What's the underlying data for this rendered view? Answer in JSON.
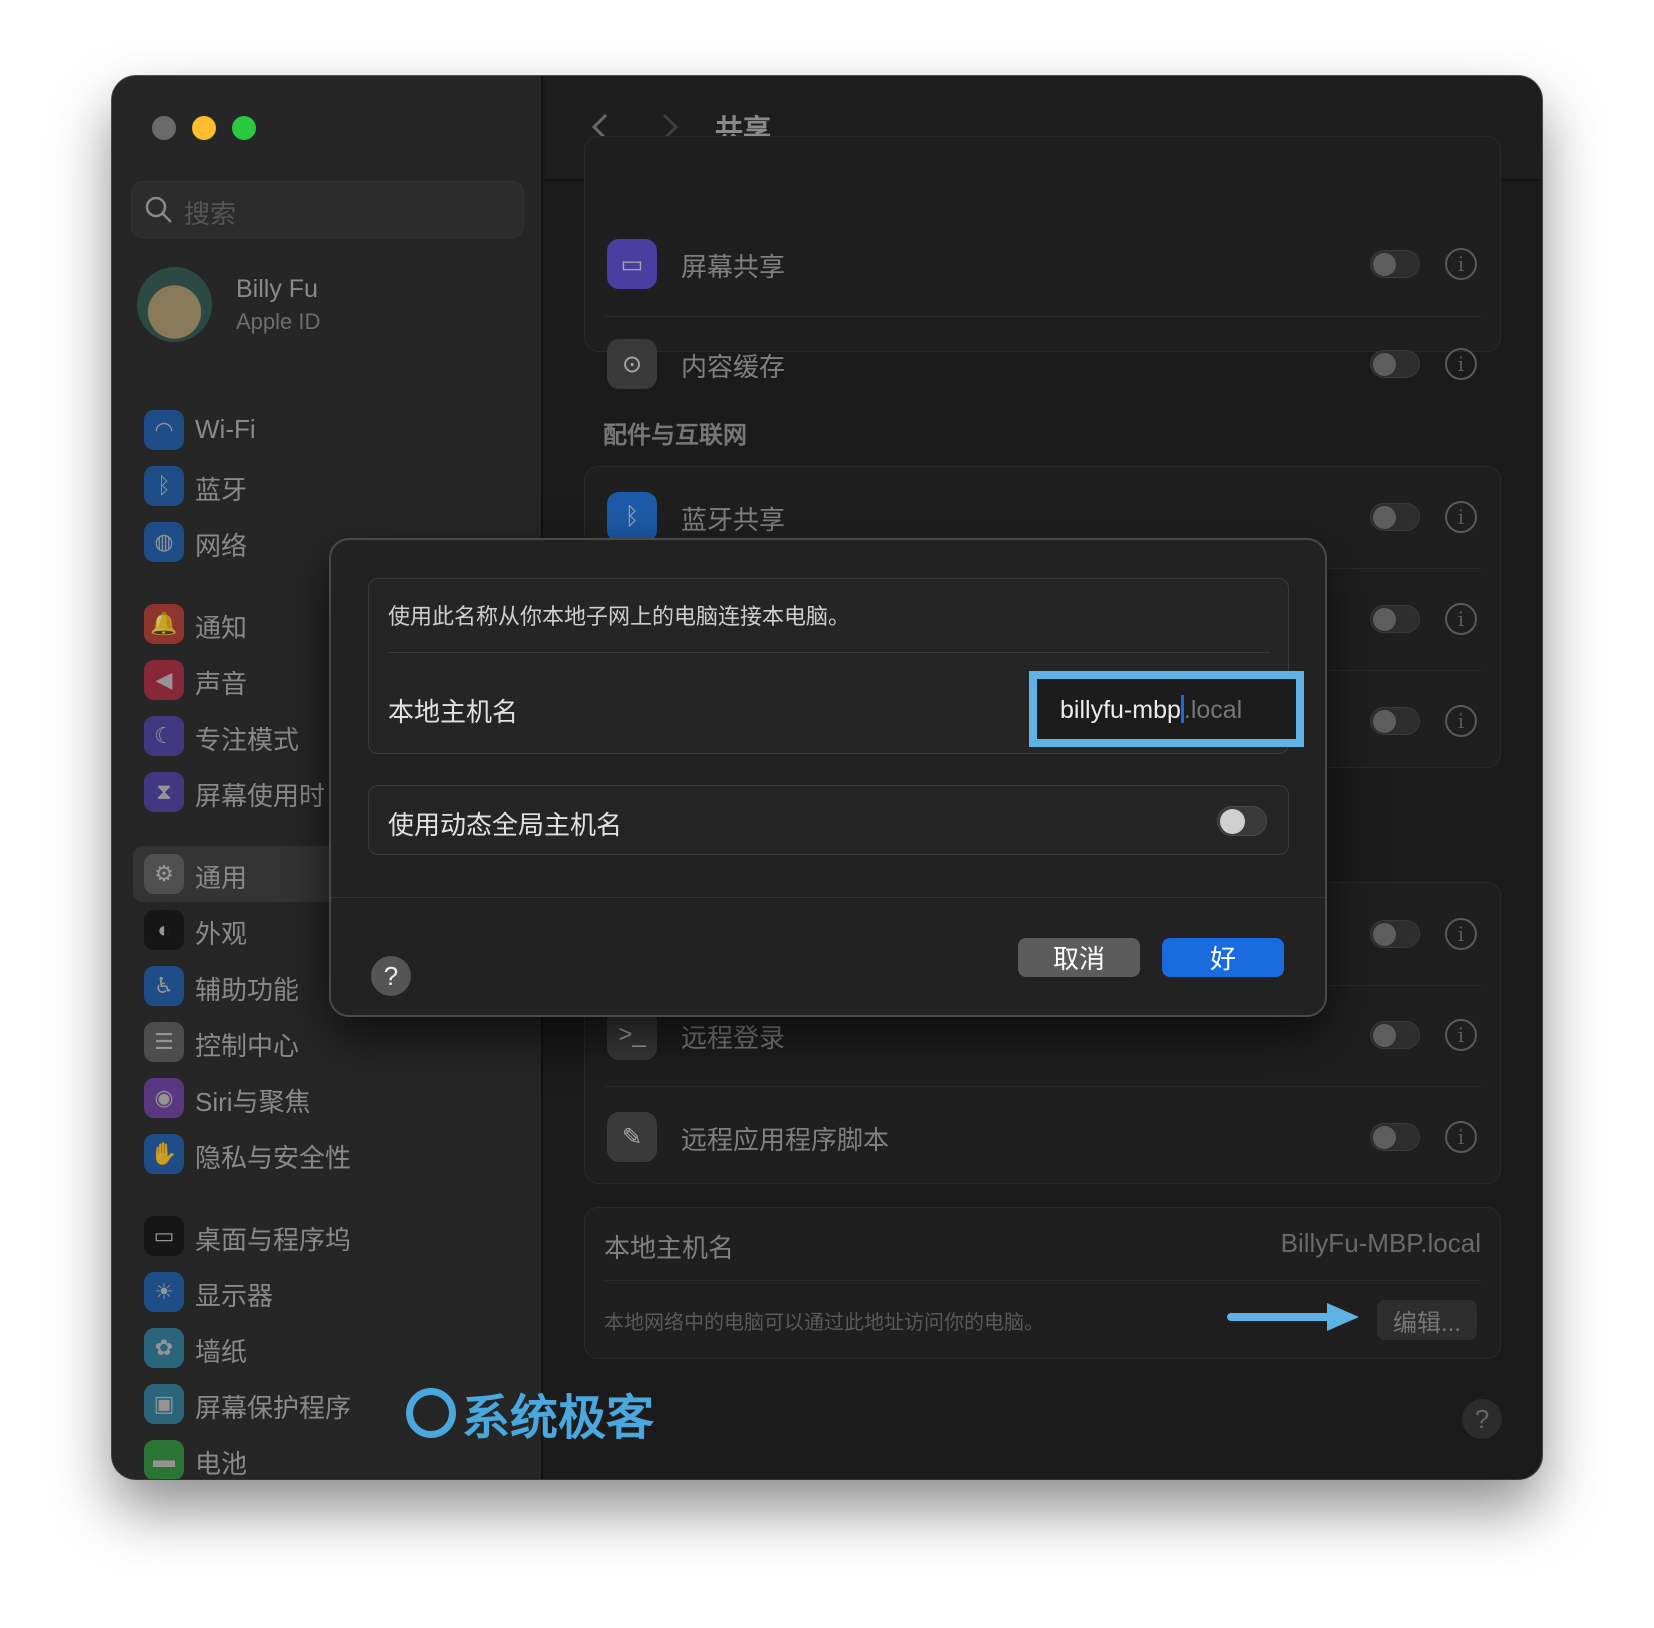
{
  "window": {
    "title": "共享"
  },
  "sidebar": {
    "search_placeholder": "搜索",
    "account": {
      "name": "Billy Fu",
      "subtitle": "Apple ID"
    },
    "items": [
      {
        "label": "Wi-Fi",
        "icon": "wifi-icon",
        "color": "#1d5aa8"
      },
      {
        "label": "蓝牙",
        "icon": "bluetooth-icon",
        "color": "#1d5aa8"
      },
      {
        "label": "网络",
        "icon": "globe-icon",
        "color": "#1d5aa8"
      },
      {
        "label": "通知",
        "icon": "bell-icon",
        "color": "#b33a33"
      },
      {
        "label": "声音",
        "icon": "speaker-icon",
        "color": "#a8283f"
      },
      {
        "label": "专注模式",
        "icon": "moon-icon",
        "color": "#4c3ea0"
      },
      {
        "label": "屏幕使用时",
        "icon": "hourglass-icon",
        "color": "#4c3ea0"
      },
      {
        "label": "通用",
        "icon": "gear-icon",
        "color": "#5a5a5a",
        "selected": true
      },
      {
        "label": "外观",
        "icon": "appearance-icon",
        "color": "#111111"
      },
      {
        "label": "辅助功能",
        "icon": "accessibility-icon",
        "color": "#1d5aa8"
      },
      {
        "label": "控制中心",
        "icon": "toggles-icon",
        "color": "#5a5a5a"
      },
      {
        "label": "Siri与聚焦",
        "icon": "siri-icon",
        "color": "#6a3fa0"
      },
      {
        "label": "隐私与安全性",
        "icon": "hand-icon",
        "color": "#1d5aa8"
      },
      {
        "label": "桌面与程序坞",
        "icon": "dock-icon",
        "color": "#111111"
      },
      {
        "label": "显示器",
        "icon": "sun-icon",
        "color": "#1d5aa8"
      },
      {
        "label": "墙纸",
        "icon": "flower-icon",
        "color": "#2c7a99"
      },
      {
        "label": "屏幕保护程序",
        "icon": "screensaver-icon",
        "color": "#2c7a99"
      },
      {
        "label": "电池",
        "icon": "battery-icon",
        "color": "#2f8f3a"
      }
    ]
  },
  "main": {
    "services_top": [
      {
        "label": "屏幕共享",
        "icon": "screen-sharing-icon",
        "enabled": false
      },
      {
        "label": "内容缓存",
        "icon": "content-cache-icon",
        "enabled": false
      }
    ],
    "section_accessories": "配件与互联网",
    "services_accessories": [
      {
        "label": "蓝牙共享",
        "icon": "bluetooth-icon",
        "enabled": false
      },
      {
        "enabled": false
      },
      {
        "enabled": false
      }
    ],
    "services_advanced": [
      {
        "enabled": false
      },
      {
        "label": "远程登录",
        "icon": "terminal-icon",
        "enabled": false
      },
      {
        "label": "远程应用程序脚本",
        "icon": "script-icon",
        "enabled": false
      }
    ],
    "hostname": {
      "label": "本地主机名",
      "value": "BillyFu-MBP.local",
      "description": "本地网络中的电脑可以通过此地址访问你的电脑。",
      "edit_label": "编辑..."
    }
  },
  "dialog": {
    "description": "使用此名称从你本地子网上的电脑连接本电脑。",
    "hostname_label": "本地主机名",
    "hostname_value": "billyfu-mbp",
    "hostname_suffix": ".local",
    "dynamic_label": "使用动态全局主机名",
    "dynamic_enabled": false,
    "help_label": "?",
    "cancel_label": "取消",
    "ok_label": "好"
  },
  "watermark": "系统极客",
  "colors": {
    "accent": "#1a6ae0",
    "focus_ring": "#5fb2e4",
    "annotation_arrow": "#5fb2e4"
  }
}
